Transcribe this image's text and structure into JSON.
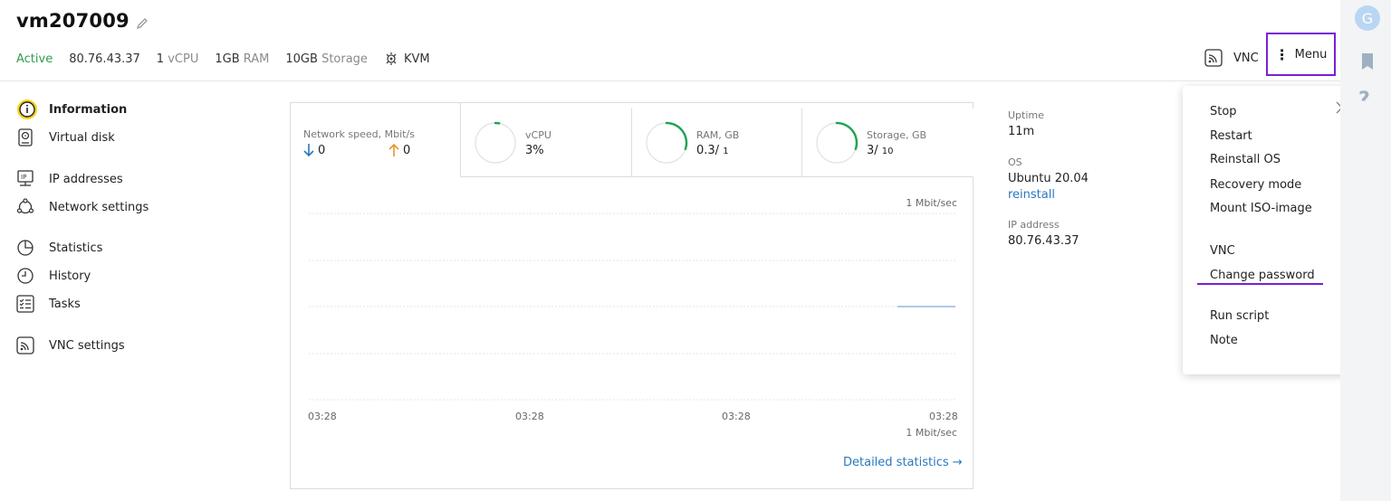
{
  "header": {
    "title": "vm207009",
    "status": "Active",
    "ip": "80.76.43.37",
    "cpu_value": "1",
    "cpu_unit": "vCPU",
    "ram_value": "1GB",
    "ram_unit": "RAM",
    "storage_value": "10GB",
    "storage_unit": "Storage",
    "virtualization": "KVM",
    "vnc_label": "VNC",
    "menu_label": "Menu",
    "avatar_initial": "G"
  },
  "sidebar": {
    "items": [
      {
        "label": "Information",
        "icon": "info-icon"
      },
      {
        "label": "Virtual disk",
        "icon": "disk-icon"
      },
      {
        "label": "IP addresses",
        "icon": "ip-icon"
      },
      {
        "label": "Network settings",
        "icon": "network-icon"
      },
      {
        "label": "Statistics",
        "icon": "pie-chart-icon"
      },
      {
        "label": "History",
        "icon": "clock-icon"
      },
      {
        "label": "Tasks",
        "icon": "checklist-icon"
      },
      {
        "label": "VNC settings",
        "icon": "vnc-icon"
      }
    ]
  },
  "tabs": {
    "network": {
      "label": "Network speed, Mbit/s",
      "down": "0",
      "up": "0"
    },
    "vcpu": {
      "label": "vCPU",
      "value": "3%"
    },
    "ram": {
      "label": "RAM, GB",
      "value": "0.3/",
      "total": "1"
    },
    "storage": {
      "label": "Storage, GB",
      "value": "3/",
      "total": "10"
    }
  },
  "chart_data": {
    "type": "line",
    "top_unit": "1 Mbit/sec",
    "bottom_unit": "1 Mbit/sec",
    "x_labels": [
      "03:28",
      "03:28",
      "03:28",
      "03:28"
    ],
    "series": [
      {
        "values": [
          0
        ]
      }
    ]
  },
  "gauges": {
    "vcpu": 0.03,
    "ram": 0.3,
    "storage": 0.3
  },
  "detail_link": "Detailed statistics →",
  "meta": {
    "uptime_label": "Uptime",
    "uptime_value": "11m",
    "os_label": "OS",
    "os_value": "Ubuntu 20.04",
    "os_link": "reinstall",
    "ip_label": "IP address",
    "ip_value": "80.76.43.37"
  },
  "menu": {
    "items": [
      "Stop",
      "Restart",
      "Reinstall OS",
      "Recovery mode",
      "Mount ISO-image",
      "VNC",
      "Change password",
      "Run script",
      "Note"
    ]
  },
  "colors": {
    "accent": "#7a1fd6",
    "status": "#2e9c4a",
    "link": "#2a78bd",
    "gauge": "#22a455",
    "down_arrow": "#2a78bd",
    "up_arrow": "#e8962b"
  }
}
